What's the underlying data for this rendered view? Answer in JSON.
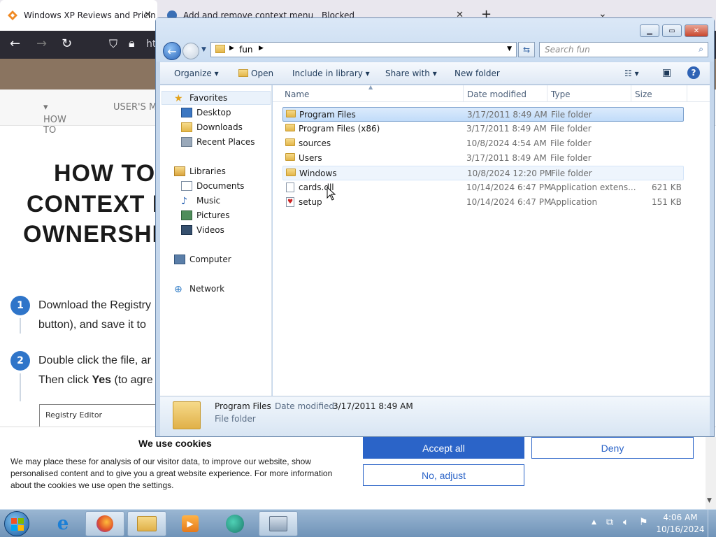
{
  "browser": {
    "tabs": [
      {
        "title": "Windows XP Reviews and Pricin"
      },
      {
        "title": "Add and remove context menu"
      },
      {
        "title": "Blocked"
      }
    ],
    "url_partial": "ht",
    "new_tab_symbol": "+"
  },
  "site": {
    "nav": [
      "HOW TO",
      "USER'S M"
    ],
    "heading_lines": [
      "HOW TO",
      "CONTEXT I",
      "OWNERSHI"
    ],
    "steps": [
      {
        "num": "1",
        "line1": "Download the Registry",
        "line2": "button), and save it to"
      },
      {
        "num": "2",
        "line1": "Double click the file, ar",
        "line2_pre": "Then click ",
        "line2_bold": "Yes",
        "line2_post": " (to agre"
      }
    ],
    "partial_box_text": "Registry Editor"
  },
  "cookie": {
    "title": "We use cookies",
    "body": "We may place these for analysis of our visitor data, to improve our website, show personalised content and to give you a great website experience. For more information about the cookies we use open the settings.",
    "accept": "Accept all",
    "deny": "Deny",
    "adjust": "No, adjust",
    "accent": "#2b64c8"
  },
  "explorer": {
    "breadcrumb": "fun",
    "search_placeholder": "Search fun",
    "commands": {
      "organize": "Organize",
      "open": "Open",
      "include": "Include in library",
      "share": "Share with",
      "newfolder": "New folder"
    },
    "nav": {
      "favorites": "Favorites",
      "desktop": "Desktop",
      "downloads": "Downloads",
      "recent": "Recent Places",
      "libraries": "Libraries",
      "documents": "Documents",
      "music": "Music",
      "pictures": "Pictures",
      "videos": "Videos",
      "computer": "Computer",
      "network": "Network"
    },
    "columns": {
      "name": "Name",
      "date": "Date modified",
      "type": "Type",
      "size": "Size"
    },
    "files": [
      {
        "name": "Program Files",
        "date": "3/17/2011 8:49 AM",
        "type": "File folder",
        "size": ""
      },
      {
        "name": "Program Files (x86)",
        "date": "3/17/2011 8:49 AM",
        "type": "File folder",
        "size": ""
      },
      {
        "name": "sources",
        "date": "10/8/2024 4:54 AM",
        "type": "File folder",
        "size": ""
      },
      {
        "name": "Users",
        "date": "3/17/2011 8:49 AM",
        "type": "File folder",
        "size": ""
      },
      {
        "name": "Windows",
        "date": "10/8/2024 12:20 PM",
        "type": "File folder",
        "size": ""
      },
      {
        "name": "cards.dll",
        "date": "10/14/2024 6:47 PM",
        "type": "Application extens...",
        "size": "621 KB"
      },
      {
        "name": "setup",
        "date": "10/14/2024 6:47 PM",
        "type": "Application",
        "size": "151 KB"
      }
    ],
    "details": {
      "name": "Program Files",
      "date_label": "Date modified:",
      "date": "3/17/2011 8:49 AM",
      "type": "File folder"
    }
  },
  "taskbar": {
    "time": "4:06 AM",
    "date": "10/16/2024"
  }
}
